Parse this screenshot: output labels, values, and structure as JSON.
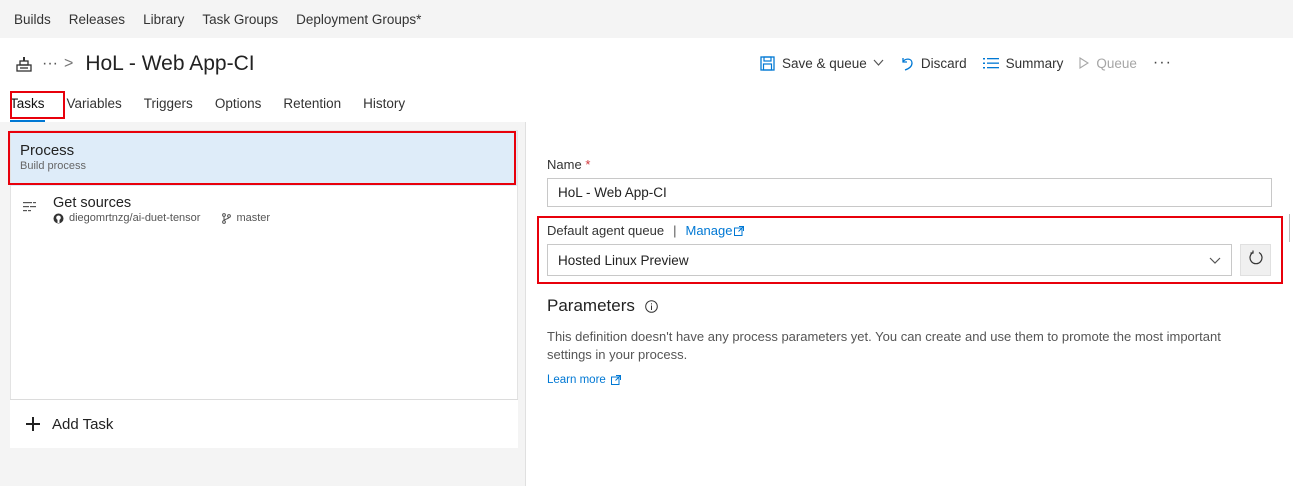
{
  "topnav": {
    "items": [
      "Builds",
      "Releases",
      "Library",
      "Task Groups",
      "Deployment Groups*"
    ]
  },
  "header": {
    "ellipsis": "···",
    "chevron": ">",
    "title": "HoL - Web App-CI"
  },
  "toolbar": {
    "save_queue": "Save & queue",
    "discard": "Discard",
    "summary": "Summary",
    "queue": "Queue",
    "more": "···"
  },
  "tabs": [
    "Tasks",
    "Variables",
    "Triggers",
    "Options",
    "Retention",
    "History"
  ],
  "active_tab": "Tasks",
  "left": {
    "process_title": "Process",
    "process_sub": "Build process",
    "sources_title": "Get sources",
    "sources_repo": "diegomrtnzg/ai-duet-tensor",
    "sources_branch": "master",
    "add_task": "Add Task"
  },
  "right": {
    "name_label": "Name",
    "required_mark": "*",
    "name_value": "HoL - Web App-CI",
    "queue_label": "Default agent queue",
    "queue_sep": "|",
    "manage": "Manage",
    "queue_value": "Hosted Linux Preview",
    "params_title": "Parameters",
    "params_desc": "This definition doesn't have any process parameters yet. You can create and use them to promote the most important settings in your process.",
    "learn_more": "Learn more"
  },
  "colors": {
    "accent": "#0078d4",
    "highlight_box": "#e8000b",
    "selected_bg": "#deecf9"
  }
}
